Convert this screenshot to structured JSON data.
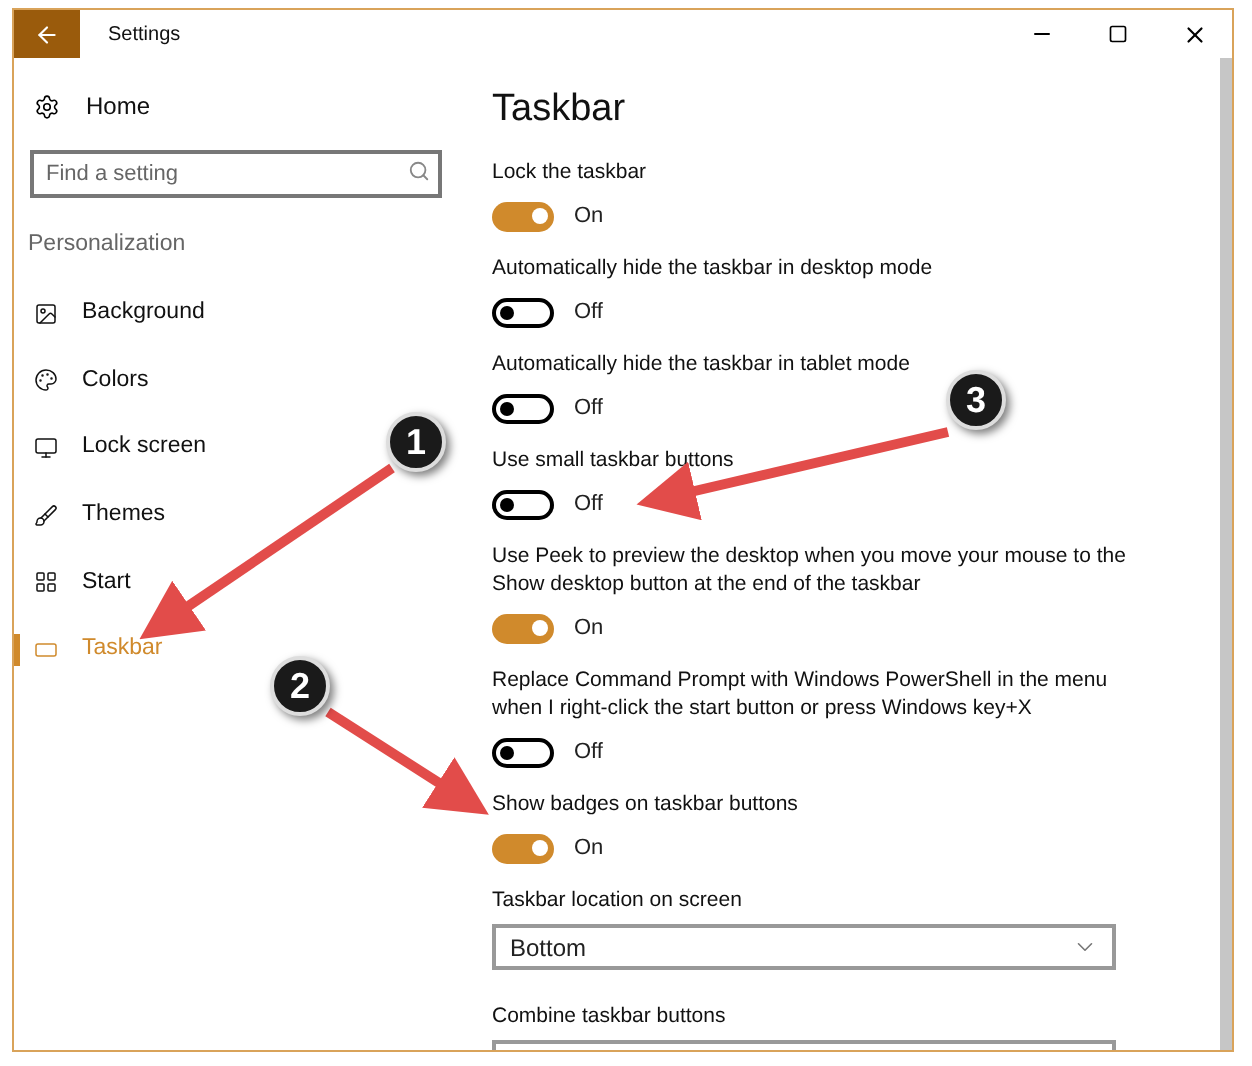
{
  "window": {
    "title": "Settings"
  },
  "sidebar": {
    "home": "Home",
    "search": {
      "placeholder": "Find a setting"
    },
    "section": "Personalization",
    "items": [
      {
        "label": "Background",
        "kind": "background",
        "selected": false
      },
      {
        "label": "Colors",
        "kind": "colors",
        "selected": false
      },
      {
        "label": "Lock screen",
        "kind": "lock",
        "selected": false
      },
      {
        "label": "Themes",
        "kind": "themes",
        "selected": false
      },
      {
        "label": "Start",
        "kind": "start",
        "selected": false
      },
      {
        "label": "Taskbar",
        "kind": "taskbar",
        "selected": true
      }
    ]
  },
  "content": {
    "heading": "Taskbar",
    "settings": [
      {
        "kind": "toggle",
        "label": "Lock the taskbar",
        "on": true,
        "state_text": "On"
      },
      {
        "kind": "toggle",
        "label": "Automatically hide the taskbar in desktop mode",
        "on": false,
        "state_text": "Off"
      },
      {
        "kind": "toggle",
        "label": "Automatically hide the taskbar in tablet mode",
        "on": false,
        "state_text": "Off"
      },
      {
        "kind": "toggle",
        "label": "Use small taskbar buttons",
        "on": false,
        "state_text": "Off"
      },
      {
        "kind": "toggle",
        "label": "Use Peek to preview the desktop when you move your mouse to the Show desktop button at the end of the taskbar",
        "on": true,
        "state_text": "On"
      },
      {
        "kind": "toggle",
        "label": "Replace Command Prompt with Windows PowerShell in the menu when I right-click the start button or press Windows key+X",
        "on": false,
        "state_text": "Off"
      },
      {
        "kind": "toggle",
        "label": "Show badges on taskbar buttons",
        "on": true,
        "state_text": "On"
      },
      {
        "kind": "dropdown",
        "label": "Taskbar location on screen",
        "value": "Bottom"
      },
      {
        "kind": "dropdown",
        "label": "Combine taskbar buttons"
      }
    ]
  },
  "annotations": [
    {
      "number": "1"
    },
    {
      "number": "2"
    },
    {
      "number": "3"
    }
  ]
}
